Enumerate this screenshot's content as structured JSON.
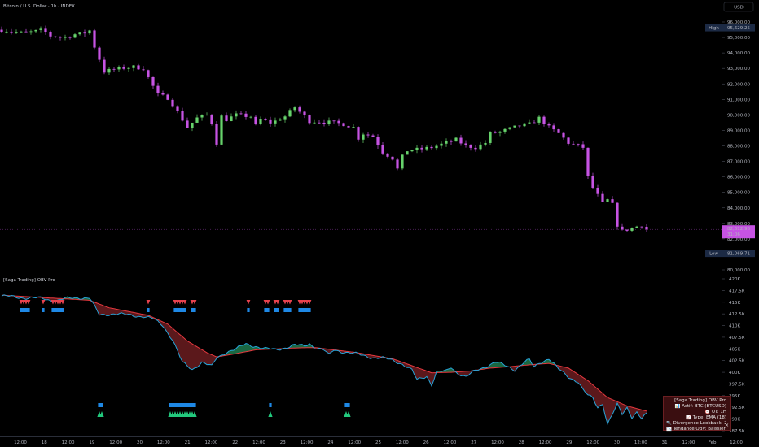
{
  "header": {
    "symbol_title": "Bitcoin / U.S. Dollar · 1h · INDEX",
    "currency": "USD"
  },
  "price_labels": {
    "high_tag": "High",
    "high_value": "95,629.25",
    "low_tag": "Low",
    "low_value": "81,069.71",
    "last_value": "82,612.96",
    "last_countdown": "31:06"
  },
  "indicator": {
    "name": "[Saga Trading] OBV Pro",
    "info_box": {
      "lines": [
        "[Saga Trading] OBV Pro",
        "📊 Actif: BTC (BTCUSD)",
        "⏰ UT: 1H",
        "📈 Type: EMA (18)",
        "🔍 Divergence Lookback: 24",
        "📉 Tendance OBV: Baissière"
      ],
      "close": "×"
    }
  },
  "colors": {
    "bull_candle": "#66d26b",
    "bear_candle": "#c653e3",
    "obv_line": "#27a4d8",
    "ema_line": "#e5383e",
    "bear_fill": "#6b1c20",
    "bull_fill": "#1f7a4e",
    "bear_signal": "#e8424e",
    "bull_signal": "#22c97d",
    "marker_blue": "#1e88e5"
  },
  "chart_data": [
    {
      "type": "candlestick",
      "title": "Bitcoin / U.S. Dollar · 1h · INDEX",
      "ylabel": "USD",
      "ylim": [
        80000,
        96000
      ],
      "yticks": [
        80000,
        81000,
        82000,
        83000,
        84000,
        85000,
        86000,
        87000,
        88000,
        89000,
        90000,
        91000,
        92000,
        93000,
        94000,
        95000,
        96000
      ],
      "ytick_labels": [
        "80,000.00",
        "81,000.00",
        "82,000.00",
        "83,000.00",
        "84,000.00",
        "85,000.00",
        "86,000.00",
        "87,000.00",
        "88,000.00",
        "89,000.00",
        "90,000.00",
        "91,000.00",
        "92,000.00",
        "93,000.00",
        "94,000.00",
        "95,000.00",
        "96,000.00"
      ],
      "x_tick_labels": [
        "12:00",
        "18",
        "12:00",
        "19",
        "12:00",
        "20",
        "12:00",
        "21",
        "12:00",
        "22",
        "12:00",
        "23",
        "12:00",
        "24",
        "12:00",
        "25",
        "12:00",
        "26",
        "12:00",
        "27",
        "12:00",
        "28",
        "12:00",
        "29",
        "12:00",
        "30",
        "12:00",
        "31",
        "12:00",
        "Feb",
        "12:00"
      ],
      "high": 95629.25,
      "low": 81069.71,
      "last": 82612.96,
      "close_path": [
        [
          0,
          95500
        ],
        [
          2,
          95400
        ],
        [
          4,
          95300
        ],
        [
          6,
          95350
        ],
        [
          8,
          95450
        ],
        [
          9,
          95350
        ],
        [
          10,
          95100
        ],
        [
          13,
          95000
        ],
        [
          15,
          95200
        ],
        [
          17,
          95300
        ],
        [
          18,
          95450
        ],
        [
          19,
          94400
        ],
        [
          21,
          92800
        ],
        [
          24,
          93000
        ],
        [
          27,
          93100
        ],
        [
          29,
          93000
        ],
        [
          30,
          92400
        ],
        [
          32,
          91300
        ],
        [
          34,
          91100
        ],
        [
          36,
          90200
        ],
        [
          38,
          89200
        ],
        [
          40,
          89800
        ],
        [
          42,
          90000
        ],
        [
          43,
          89500
        ],
        [
          44,
          88200
        ],
        [
          45,
          89900
        ],
        [
          46,
          89700
        ],
        [
          48,
          90000
        ],
        [
          51,
          89900
        ],
        [
          52,
          89300
        ],
        [
          53,
          89700
        ],
        [
          55,
          89500
        ],
        [
          56,
          89600
        ],
        [
          58,
          89900
        ],
        [
          60,
          90500
        ],
        [
          61,
          90200
        ],
        [
          62,
          89900
        ],
        [
          63,
          89600
        ],
        [
          66,
          89550
        ],
        [
          68,
          89500
        ],
        [
          70,
          89400
        ],
        [
          72,
          89200
        ],
        [
          73,
          88500
        ],
        [
          74,
          88800
        ],
        [
          76,
          88600
        ],
        [
          78,
          87600
        ],
        [
          80,
          87200
        ],
        [
          81,
          86500
        ],
        [
          82,
          87300
        ],
        [
          83,
          87700
        ],
        [
          86,
          87800
        ],
        [
          88,
          87900
        ],
        [
          90,
          88100
        ],
        [
          93,
          88400
        ],
        [
          95,
          88000
        ],
        [
          97,
          87900
        ],
        [
          99,
          88200
        ],
        [
          100,
          88800
        ],
        [
          102,
          88900
        ],
        [
          104,
          89100
        ],
        [
          106,
          89300
        ],
        [
          108,
          89400
        ],
        [
          110,
          89800
        ],
        [
          111,
          89500
        ],
        [
          112,
          89200
        ],
        [
          114,
          88800
        ],
        [
          116,
          88200
        ],
        [
          118,
          88000
        ],
        [
          119,
          87900
        ],
        [
          120,
          86000
        ],
        [
          121,
          85300
        ],
        [
          123,
          84300
        ],
        [
          124,
          84500
        ],
        [
          125,
          84200
        ],
        [
          126,
          82900
        ],
        [
          127,
          82500
        ],
        [
          129,
          82700
        ],
        [
          131,
          82900
        ],
        [
          132,
          82613
        ]
      ]
    },
    {
      "type": "line",
      "title": "[Saga Trading] OBV Pro",
      "ylim": [
        387500,
        420000
      ],
      "yticks": [
        387500,
        390000,
        392500,
        395000,
        397500,
        400000,
        402500,
        405000,
        407500,
        410000,
        412500,
        415000,
        417500,
        420000
      ],
      "ytick_labels": [
        "387.5K",
        "390K",
        "392.5K",
        "395K",
        "397.5K",
        "400K",
        "402.5K",
        "405K",
        "407.5K",
        "410K",
        "412.5K",
        "415K",
        "417.5K",
        "420K"
      ],
      "series": [
        {
          "role": "obv",
          "points": [
            [
              0,
              416300
            ],
            [
              4,
              416000
            ],
            [
              8,
              415800
            ],
            [
              11,
              415300
            ],
            [
              13,
              415700
            ],
            [
              16,
              416000
            ],
            [
              18,
              415900
            ],
            [
              20,
              412200
            ],
            [
              23,
              412600
            ],
            [
              26,
              412200
            ],
            [
              29,
              412000
            ],
            [
              31,
              411400
            ],
            [
              33,
              410000
            ],
            [
              35,
              407000
            ],
            [
              37,
              402000
            ],
            [
              39,
              400600
            ],
            [
              41,
              402200
            ],
            [
              43,
              401200
            ],
            [
              44,
              403000
            ],
            [
              46,
              404400
            ],
            [
              48,
              405000
            ],
            [
              50,
              406000
            ],
            [
              52,
              405600
            ],
            [
              54,
              405000
            ],
            [
              56,
              404800
            ],
            [
              58,
              405300
            ],
            [
              60,
              405800
            ],
            [
              62,
              405600
            ],
            [
              63,
              406200
            ],
            [
              64,
              405400
            ],
            [
              66,
              404700
            ],
            [
              67,
              403600
            ],
            [
              68,
              404800
            ],
            [
              70,
              404400
            ],
            [
              72,
              404000
            ],
            [
              74,
              403600
            ],
            [
              76,
              403200
            ],
            [
              78,
              403000
            ],
            [
              80,
              402600
            ],
            [
              82,
              401800
            ],
            [
              84,
              400400
            ],
            [
              85,
              398300
            ],
            [
              86,
              398800
            ],
            [
              87,
              399200
            ],
            [
              88,
              397400
            ],
            [
              89,
              400000
            ],
            [
              91,
              400200
            ],
            [
              92,
              401100
            ],
            [
              93,
              400100
            ],
            [
              95,
              399000
            ],
            [
              97,
              400300
            ],
            [
              99,
              401200
            ],
            [
              101,
              402200
            ],
            [
              103,
              401400
            ],
            [
              105,
              400600
            ],
            [
              106,
              401400
            ],
            [
              107,
              402200
            ],
            [
              108,
              402600
            ],
            [
              109,
              401000
            ],
            [
              110,
              402000
            ],
            [
              112,
              403000
            ],
            [
              114,
              400600
            ],
            [
              116,
              399000
            ],
            [
              118,
              398000
            ],
            [
              119,
              396200
            ],
            [
              120,
              395000
            ],
            [
              121,
              394400
            ],
            [
              122,
              392500
            ],
            [
              123,
              393400
            ],
            [
              124,
              389000
            ],
            [
              125,
              391000
            ],
            [
              126,
              393000
            ],
            [
              127,
              391000
            ],
            [
              128,
              392500
            ],
            [
              129,
              390500
            ],
            [
              130,
              391500
            ],
            [
              131,
              390000
            ],
            [
              132,
              391000
            ]
          ]
        },
        {
          "role": "ema",
          "period": 18,
          "points": [
            [
              0,
              416500
            ],
            [
              8,
              416000
            ],
            [
              15,
              415600
            ],
            [
              18,
              415400
            ],
            [
              22,
              413800
            ],
            [
              26,
              413000
            ],
            [
              30,
              412200
            ],
            [
              34,
              410300
            ],
            [
              38,
              406700
            ],
            [
              42,
              404200
            ],
            [
              44,
              403300
            ],
            [
              48,
              404000
            ],
            [
              52,
              404800
            ],
            [
              56,
              405000
            ],
            [
              60,
              405200
            ],
            [
              64,
              405300
            ],
            [
              68,
              404800
            ],
            [
              72,
              404300
            ],
            [
              76,
              403600
            ],
            [
              80,
              402900
            ],
            [
              84,
              401400
            ],
            [
              88,
              399900
            ],
            [
              92,
              400000
            ],
            [
              96,
              400300
            ],
            [
              100,
              400900
            ],
            [
              104,
              401200
            ],
            [
              108,
              401600
            ],
            [
              112,
              401900
            ],
            [
              116,
              400900
            ],
            [
              120,
              398200
            ],
            [
              124,
              394600
            ],
            [
              128,
              392800
            ],
            [
              132,
              391700
            ]
          ]
        }
      ],
      "bear_signal_x": [
        8,
        9,
        10,
        11,
        17,
        21,
        22,
        23,
        24,
        25,
        60,
        71,
        72,
        73,
        74,
        75,
        78,
        79,
        101,
        108,
        109,
        112,
        113,
        116,
        117,
        118,
        122,
        123,
        124,
        125,
        126
      ],
      "bull_signal_x": [
        40,
        41,
        69,
        70,
        71,
        72,
        73,
        74,
        75,
        76,
        77,
        78,
        79,
        110,
        141,
        142
      ]
    }
  ]
}
